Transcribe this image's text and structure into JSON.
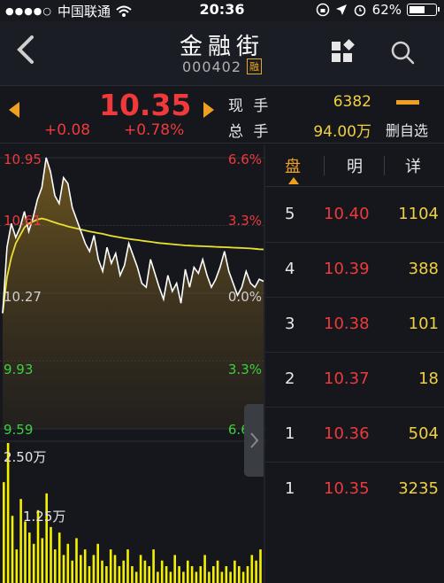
{
  "status": {
    "signal": "●●●●○",
    "carrier": "中国联通",
    "time": "20:36",
    "battery_text": "62%",
    "battery_level": 0.62
  },
  "header": {
    "back_icon": "chevron-left-icon",
    "title": "金融街",
    "code": "000402",
    "tag": "融",
    "icons": [
      "grid-icon",
      "search-icon"
    ]
  },
  "quote": {
    "price": "10.35",
    "change": "+0.08",
    "change_pct": "+0.78%",
    "now_label": "现 手",
    "now_value": "6382",
    "total_label": "总 手",
    "total_value": "94.00万",
    "watch_label": "删自选",
    "colors": {
      "up": "#ee3a3a",
      "down": "#3ecf3e",
      "accent": "#f0a020",
      "volume": "#f5f000"
    }
  },
  "chart_labels": {
    "price_high": "10.95",
    "price_mid_high": "10.61",
    "price_base": "10.27",
    "price_mid_low": "9.93",
    "price_low": "9.59",
    "pct_high": "6.6%",
    "pct_mid_high": "3.3%",
    "pct_base": "0.0%",
    "pct_mid_low": "3.3%",
    "pct_low": "6.6%",
    "vol_top": "2.50万",
    "vol_mid": "1.25万"
  },
  "side_panel": {
    "tabs": [
      "盘",
      "明",
      "详"
    ],
    "rows": [
      {
        "level": "5",
        "price": "10.40",
        "volume": "1104"
      },
      {
        "level": "4",
        "price": "10.39",
        "volume": "388"
      },
      {
        "level": "3",
        "price": "10.38",
        "volume": "101"
      },
      {
        "level": "2",
        "price": "10.37",
        "volume": "18"
      },
      {
        "level": "1",
        "price": "10.36",
        "volume": "504"
      },
      {
        "level": "1",
        "price": "10.35",
        "volume": "3235"
      }
    ]
  },
  "chart_data": {
    "type": "line",
    "ylim": [
      9.59,
      10.95
    ],
    "series": [
      {
        "values": [
          10.17,
          10.5,
          10.62,
          10.55,
          10.6,
          10.68,
          10.58,
          10.65,
          10.74,
          10.8,
          10.95,
          10.88,
          10.76,
          10.72,
          10.85,
          10.82,
          10.7,
          10.64,
          10.58,
          10.52,
          10.48,
          10.56,
          10.44,
          10.38,
          10.5,
          10.42,
          10.47,
          10.36,
          10.41,
          10.52,
          10.46,
          10.4,
          10.32,
          10.3,
          10.44,
          10.37,
          10.3,
          10.24,
          10.36,
          10.28,
          10.32,
          10.22,
          10.39,
          10.3,
          10.4,
          10.37,
          10.44,
          10.36,
          10.3,
          10.34,
          10.4,
          10.48,
          10.38,
          10.32,
          10.26,
          10.3,
          10.38,
          10.32,
          10.3,
          10.34,
          10.33
        ]
      },
      {
        "values": [
          10.17,
          10.35,
          10.45,
          10.52,
          10.56,
          10.6,
          10.62,
          10.63,
          10.64,
          10.645,
          10.64,
          10.632,
          10.625,
          10.618,
          10.612,
          10.605,
          10.6,
          10.595,
          10.59,
          10.585,
          10.58,
          10.576,
          10.572,
          10.568,
          10.563,
          10.558,
          10.554,
          10.55,
          10.546,
          10.543,
          10.54,
          10.537,
          10.534,
          10.531,
          10.528,
          10.525,
          10.522,
          10.52,
          10.518,
          10.516,
          10.514,
          10.512,
          10.51,
          10.509,
          10.508,
          10.507,
          10.506,
          10.505,
          10.504,
          10.503,
          10.502,
          10.501,
          10.5,
          10.499,
          10.498,
          10.497,
          10.496,
          10.495,
          10.493,
          10.491,
          10.49
        ]
      }
    ],
    "volume": [
      1.8,
      2.5,
      1.2,
      0.6,
      1.5,
      1.1,
      0.9,
      0.7,
      1.3,
      0.8,
      1.6,
      1.0,
      0.6,
      0.9,
      0.5,
      0.7,
      0.4,
      0.8,
      0.5,
      0.6,
      0.3,
      0.5,
      0.7,
      0.4,
      0.3,
      0.6,
      0.5,
      0.3,
      0.4,
      0.6,
      0.3,
      0.2,
      0.5,
      0.4,
      0.3,
      0.6,
      0.2,
      0.4,
      0.3,
      0.2,
      0.5,
      0.3,
      0.2,
      0.4,
      0.3,
      0.2,
      0.3,
      0.5,
      0.2,
      0.3,
      0.4,
      0.2,
      0.3,
      0.2,
      0.4,
      0.3,
      0.2,
      0.3,
      0.5,
      0.4,
      0.6
    ]
  }
}
